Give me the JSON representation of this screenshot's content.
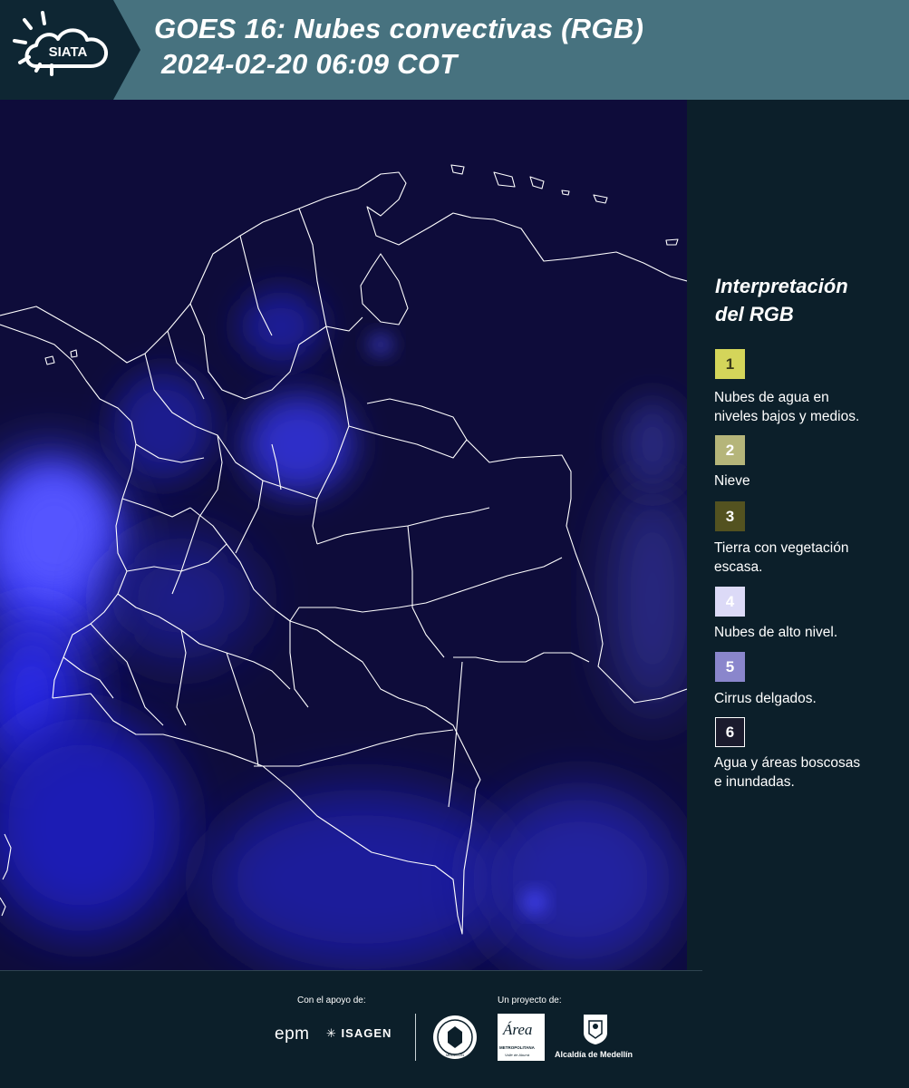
{
  "header": {
    "logo_text": "SIATA",
    "title_line1": "GOES 16: Nubes convectivas (RGB)",
    "title_line2": "2024-02-20 06:09 COT"
  },
  "map": {
    "background_color": "#0e0c3a",
    "boundary_color": "#ffffff"
  },
  "legend": {
    "title_line1": "Interpretación",
    "title_line2": "del RGB",
    "items": [
      {
        "number": "1",
        "label_line1": "Nubes de agua en",
        "label_line2": "niveles bajos y medios.",
        "color": "#d4d55a",
        "text_color": "#3b3b1a"
      },
      {
        "number": "2",
        "label_line1": "Nieve",
        "label_line2": "",
        "color": "#b5b57a",
        "text_color": "#ffffff"
      },
      {
        "number": "3",
        "label_line1": "Tierra con vegetación",
        "label_line2": "escasa.",
        "color": "#535220",
        "text_color": "#ffffff"
      },
      {
        "number": "4",
        "label_line1": "Nubes de alto nivel.",
        "label_line2": "",
        "color": "#dcdaf7",
        "text_color": "#ffffff"
      },
      {
        "number": "5",
        "label_line1": "Cirrus delgados.",
        "label_line2": "",
        "color": "#8a86cc",
        "text_color": "#ffffff"
      },
      {
        "number": "6",
        "label_line1": "Agua y áreas boscosas",
        "label_line2": "e inundadas.",
        "color": "#1b1b2d",
        "text_color": "#ffffff"
      }
    ]
  },
  "footer": {
    "support_label": "Con el apoyo de:",
    "project_label": "Un proyecto de:",
    "sponsor_epm": "epm",
    "sponsor_isagen": "ISAGEN",
    "sponsor_area_1": "Área",
    "sponsor_area_2": "METROPOLITANA",
    "sponsor_area_3": "Valle de Aburrá",
    "sponsor_alcaldia": "Alcaldía de Medellín",
    "sponsor_seal_text": "MEDELLÍN"
  }
}
